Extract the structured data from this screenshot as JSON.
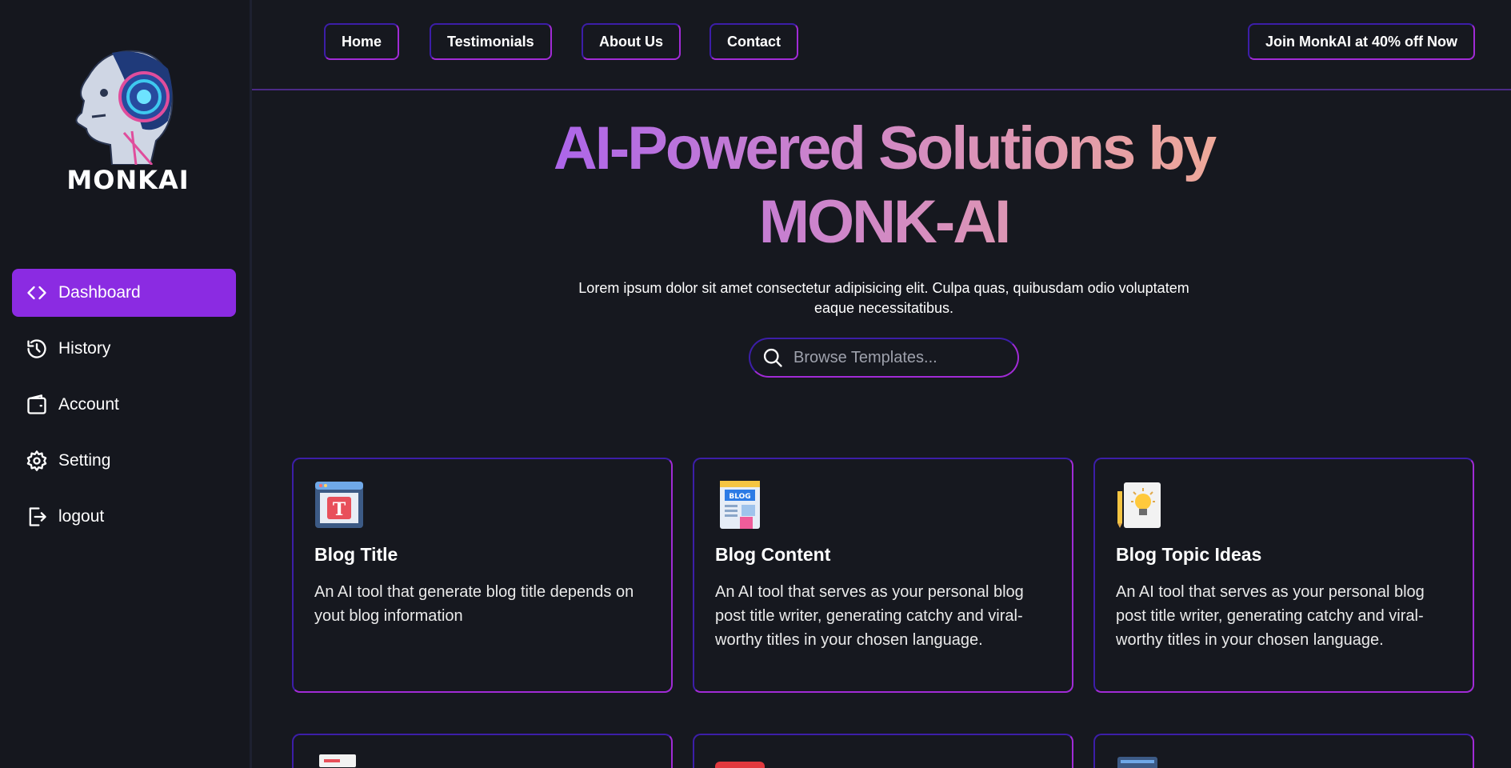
{
  "brand": {
    "name": "MONKAI"
  },
  "sidebar": {
    "items": [
      {
        "label": "Dashboard",
        "icon": "code-icon",
        "active": true
      },
      {
        "label": "History",
        "icon": "history-icon",
        "active": false
      },
      {
        "label": "Account",
        "icon": "wallet-icon",
        "active": false
      },
      {
        "label": "Setting",
        "icon": "gear-icon",
        "active": false
      },
      {
        "label": "logout",
        "icon": "logout-icon",
        "active": false
      }
    ]
  },
  "topnav": {
    "links": [
      "Home",
      "Testimonials",
      "About Us",
      "Contact"
    ],
    "cta": "Join MonkAI at 40% off Now"
  },
  "hero": {
    "title_line1": "AI-Powered Solutions by",
    "title_line2": "MONK-AI",
    "subtitle": "Lorem ipsum dolor sit amet consectetur adipisicing elit. Culpa quas, quibusdam odio voluptatem eaque necessitatibus.",
    "search_placeholder": "Browse Templates..."
  },
  "cards": [
    {
      "title": "Blog Title",
      "description": "An AI tool that generate blog title depends on yout blog information",
      "icon": "blog-title-icon"
    },
    {
      "title": "Blog Content",
      "description": "An AI tool that serves as your personal blog post title writer, generating catchy and viral-worthy titles in your chosen language.",
      "icon": "blog-content-icon"
    },
    {
      "title": "Blog Topic Ideas",
      "description": "An AI tool that serves as your personal blog post title writer, generating catchy and viral-worthy titles in your chosen language.",
      "icon": "lightbulb-icon"
    }
  ],
  "colors": {
    "accent": "#8b2be2",
    "background": "#16181f",
    "border_start": "#3c1ea8",
    "border_end": "#a12bd6",
    "title_gradient": [
      "#a35cf3",
      "#cf86c9",
      "#f5b08f"
    ]
  }
}
